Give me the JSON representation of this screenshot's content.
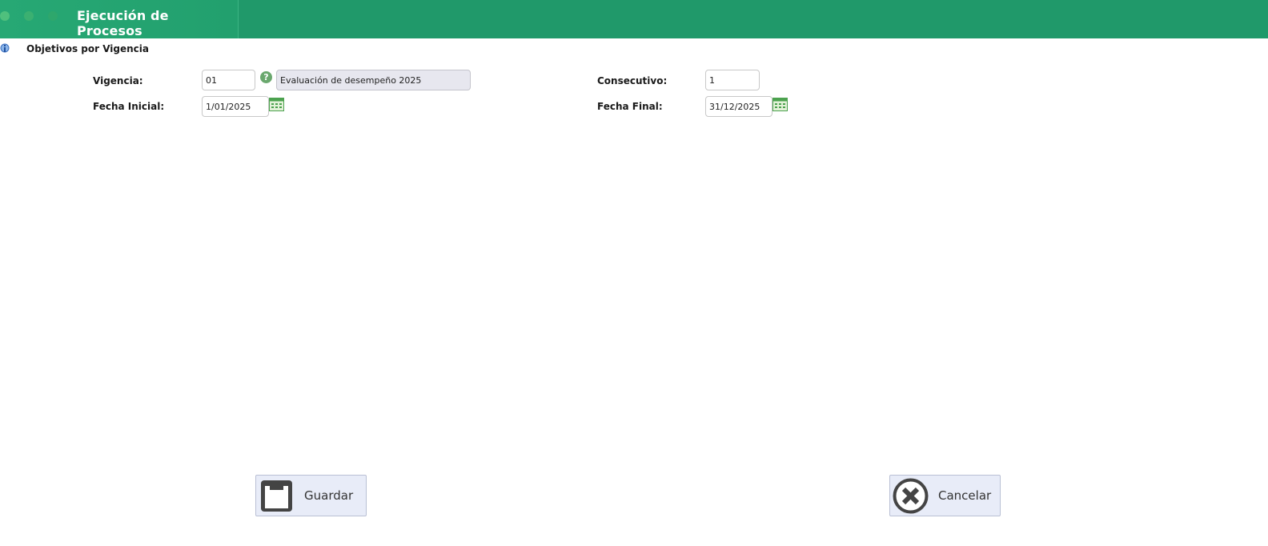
{
  "window": {
    "title": "Ejecución de Procesos"
  },
  "section": {
    "title": "Objetivos por Vigencia",
    "icon": "info-icon"
  },
  "form": {
    "vigencia": {
      "label": "Vigencia:",
      "code": "01",
      "description": "Evaluación de desempeño 2025"
    },
    "consecutivo": {
      "label": "Consecutivo:",
      "value": "1"
    },
    "fecha_inicial": {
      "label": "Fecha Inicial:",
      "value": "1/01/2025"
    },
    "fecha_final": {
      "label": "Fecha Final:",
      "value": "31/12/2025"
    }
  },
  "actions": {
    "save_label": "Guardar",
    "cancel_label": "Cancelar"
  },
  "colors": {
    "header": "#20996a",
    "button_bg": "#e8ecf8",
    "calendar_icon": "#4ca24f"
  }
}
